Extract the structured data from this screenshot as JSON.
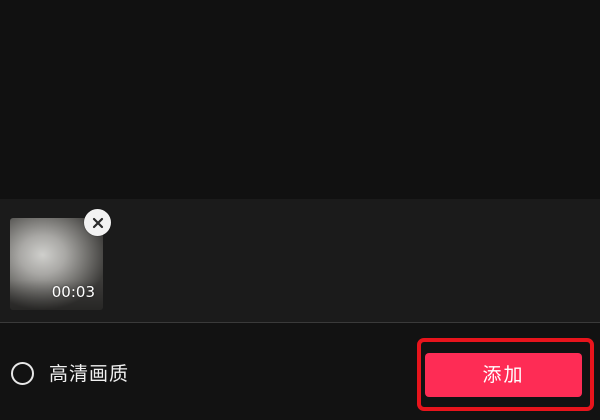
{
  "preview": {},
  "selected_clips": [
    {
      "duration": "00:03",
      "remove_icon": "close-icon"
    }
  ],
  "options": {
    "hd_quality_label": "高清画质",
    "hd_quality_checked": false
  },
  "actions": {
    "add_label": "添加"
  },
  "colors": {
    "accent": "#fe2c55",
    "highlight": "#e8141c",
    "background": "#121212"
  }
}
